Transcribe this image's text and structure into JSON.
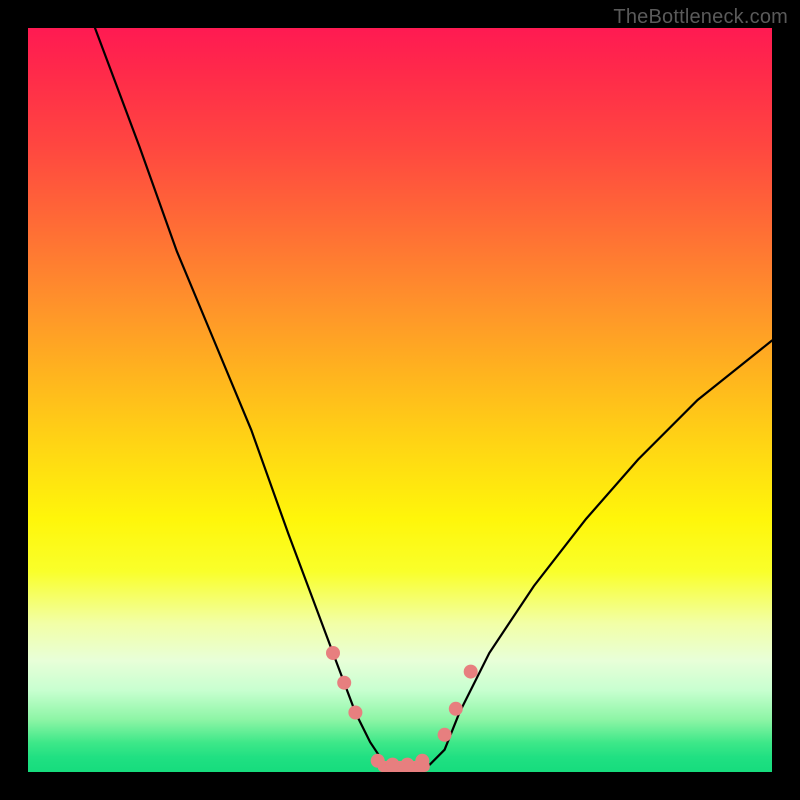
{
  "watermark": "TheBottleneck.com",
  "chart_data": {
    "type": "line",
    "title": "",
    "xlabel": "",
    "ylabel": "",
    "xlim": [
      0,
      100
    ],
    "ylim": [
      0,
      100
    ],
    "series": [
      {
        "name": "bottleneck-curve",
        "x": [
          9,
          15,
          20,
          25,
          30,
          35,
          38,
          41,
          44,
          46,
          48,
          50,
          52,
          54,
          56,
          58,
          62,
          68,
          75,
          82,
          90,
          100
        ],
        "values": [
          100,
          84,
          70,
          58,
          46,
          32,
          24,
          16,
          8,
          4,
          1,
          0.5,
          0.5,
          1,
          3,
          8,
          16,
          25,
          34,
          42,
          50,
          58
        ]
      }
    ],
    "markers": [
      {
        "name": "left-cluster-top",
        "x": 41.0,
        "y": 16.0
      },
      {
        "name": "left-cluster-mid",
        "x": 42.5,
        "y": 12.0
      },
      {
        "name": "left-cluster-low",
        "x": 44.0,
        "y": 8.0
      },
      {
        "name": "trough-1",
        "x": 47.0,
        "y": 1.5
      },
      {
        "name": "trough-2",
        "x": 49.0,
        "y": 1.0
      },
      {
        "name": "trough-3",
        "x": 51.0,
        "y": 1.0
      },
      {
        "name": "trough-4",
        "x": 53.0,
        "y": 1.5
      },
      {
        "name": "right-cluster-low",
        "x": 56.0,
        "y": 5.0
      },
      {
        "name": "right-cluster-mid",
        "x": 57.5,
        "y": 8.5
      },
      {
        "name": "right-cluster-top",
        "x": 59.5,
        "y": 13.5
      }
    ],
    "trough_bar": {
      "x_start": 47,
      "x_end": 54,
      "y": 0.8
    },
    "colors": {
      "curve": "#000000",
      "marker_fill": "#e77f7f",
      "marker_stroke": "#d36a6a",
      "gradient_top": "#ff1a52",
      "gradient_bottom": "#16dc7d"
    }
  }
}
